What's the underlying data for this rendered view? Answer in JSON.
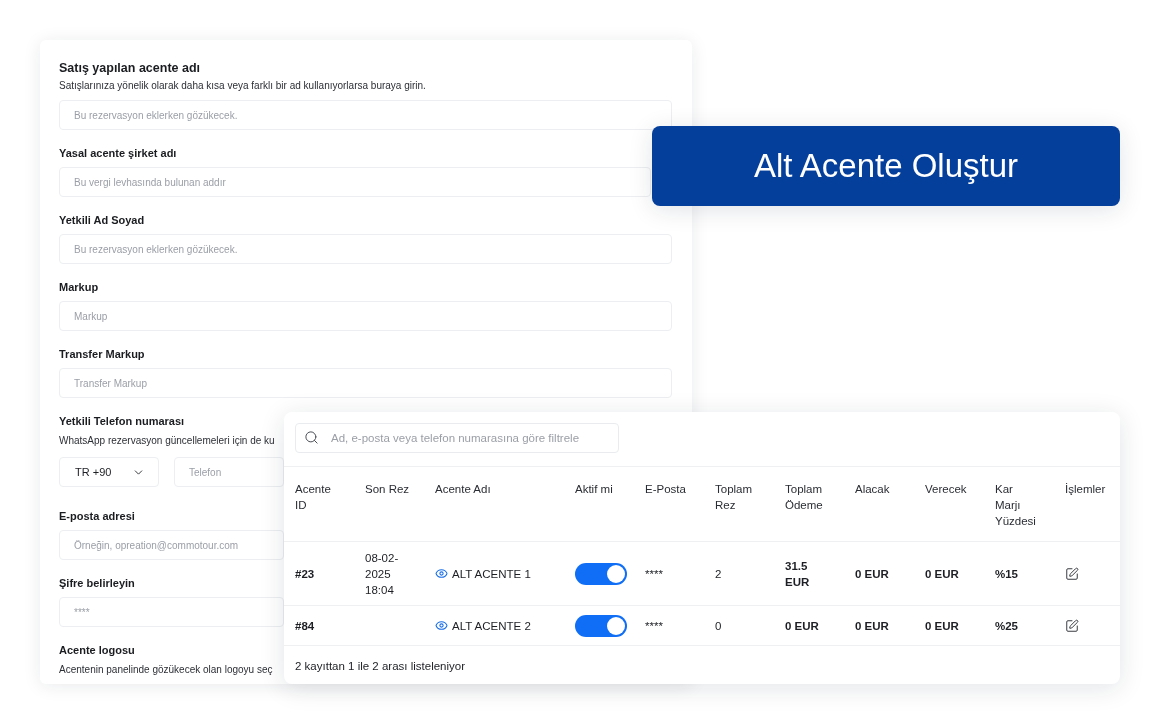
{
  "form": {
    "sections": [
      {
        "kind": "text",
        "label": "Satış yapılan acente adı",
        "help": "Satışlarınıza yönelik olarak daha kısa veya farklı bir ad kullanıyorlarsa buraya girin.",
        "placeholder": "Bu rezervasyon eklerken gözükecek."
      },
      {
        "kind": "text",
        "label": "Yasal acente şirket adı",
        "placeholder": "Bu vergi levhasında bulunan addır"
      },
      {
        "kind": "text",
        "label": "Yetkili Ad Soyad",
        "placeholder": "Bu rezervasyon eklerken gözükecek."
      },
      {
        "kind": "text",
        "label": "Markup",
        "placeholder": "Markup"
      },
      {
        "kind": "text",
        "label": "Transfer Markup",
        "placeholder": "Transfer Markup"
      },
      {
        "kind": "phone",
        "label": "Yetkili Telefon numarası",
        "help": "WhatsApp rezervasyon güncellemeleri için de ku",
        "country_code": "TR +90",
        "placeholder": "Telefon"
      },
      {
        "kind": "text",
        "label": "E-posta adresi",
        "placeholder": "Örneğin, opreation@commotour.com"
      },
      {
        "kind": "text",
        "label": "Şifre belirleyin",
        "placeholder": "****"
      },
      {
        "kind": "heading",
        "label": "Acente logosu",
        "help": "Acentenin panelinde gözükecek olan logoyu seç"
      }
    ]
  },
  "create_button": {
    "label": "Alt Acente Oluştur"
  },
  "table": {
    "search": {
      "placeholder": "Ad, e-posta veya telefon numarasına göre filtrele"
    },
    "columns": [
      "Acente ID",
      "Son Rez",
      "Acente Adı",
      "Aktif mi",
      "E-Posta",
      "Toplam Rez",
      "Toplam Ödeme",
      "Alacak",
      "Verecek",
      "Kar Marjı Yüzdesi",
      "İşlemler"
    ],
    "rows": [
      {
        "id": "#23",
        "last_reservation": "08-02-2025 18:04",
        "name": "ALT ACENTE 1",
        "active": true,
        "email": "****",
        "total_reservations": "2",
        "total_payment": "31.5 EUR",
        "receivable": "0 EUR",
        "payable": "0 EUR",
        "margin": "%15"
      },
      {
        "id": "#84",
        "name": "ALT ACENTE 2",
        "active": true,
        "email": "****",
        "total_reservations": "0",
        "total_payment": "0 EUR",
        "receivable": "0 EUR",
        "payable": "0 EUR",
        "margin": "%25"
      }
    ],
    "footer": "2 kayıttan 1 ile 2 arası listeleniyor"
  }
}
